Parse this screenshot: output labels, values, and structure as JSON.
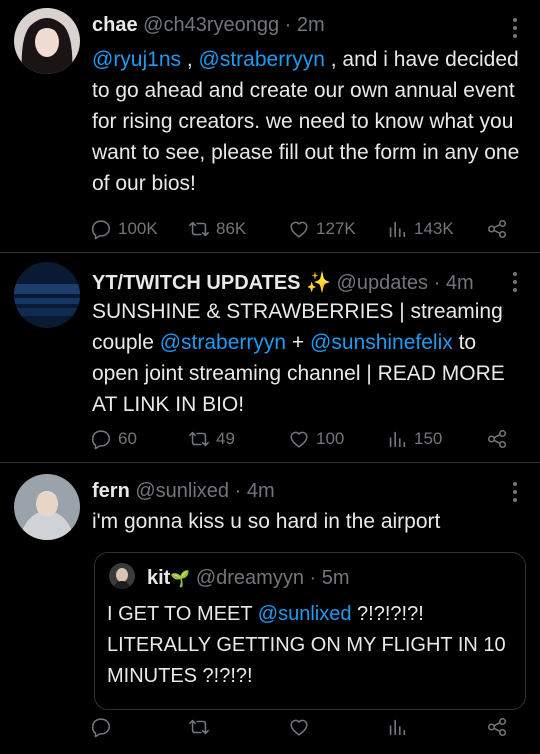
{
  "tweets": [
    {
      "name": "chae",
      "handle": "@ch43ryeongg",
      "time": "2m",
      "body": {
        "m1": "@ryuj1ns",
        "t1": " , ",
        "m2": "@straberryyn",
        "t2": " , and i have decided to go ahead and create our own annual event for rising creators. we need to know what you want to see, please fill out the form in any one of our bios!"
      },
      "actions": {
        "replies": "100K",
        "retweets": "86K",
        "likes": "127K",
        "views": "143K"
      }
    },
    {
      "name": "YT/TWITCH UPDATES",
      "badge": "✨",
      "handle": "@updates",
      "time": "4m",
      "body": {
        "t1": "SUNSHINE & STRAWBERRIES | streaming couple ",
        "m1": "@straberryyn",
        "t2": " + ",
        "m2": "@sunshinefelix",
        "t3": " to open joint streaming channel | READ MORE AT LINK IN BIO!"
      },
      "actions": {
        "replies": "60",
        "retweets": "49",
        "likes": "100",
        "views": "150"
      }
    },
    {
      "name": "fern",
      "handle": "@sunlixed",
      "time": "4m",
      "body": {
        "t1": "i'm gonna kiss u so hard in the airport"
      },
      "quote": {
        "name": "kit",
        "badge": "🌱",
        "handle": "@dreamyyn",
        "time": "5m",
        "t1": "I GET TO MEET ",
        "m1": "@sunlixed",
        "t2": " ?!?!?!?! LITERALLY GETTING ON MY FLIGHT IN 10 MINUTES ?!?!?!"
      },
      "actions": {
        "replies": "",
        "retweets": "",
        "likes": "",
        "views": ""
      }
    }
  ],
  "dot_separator": "·",
  "colors": {
    "background": "#000000",
    "text": "#e7e9ea",
    "muted": "#71767b",
    "link": "#1d9bf0",
    "border": "#2f3336"
  }
}
